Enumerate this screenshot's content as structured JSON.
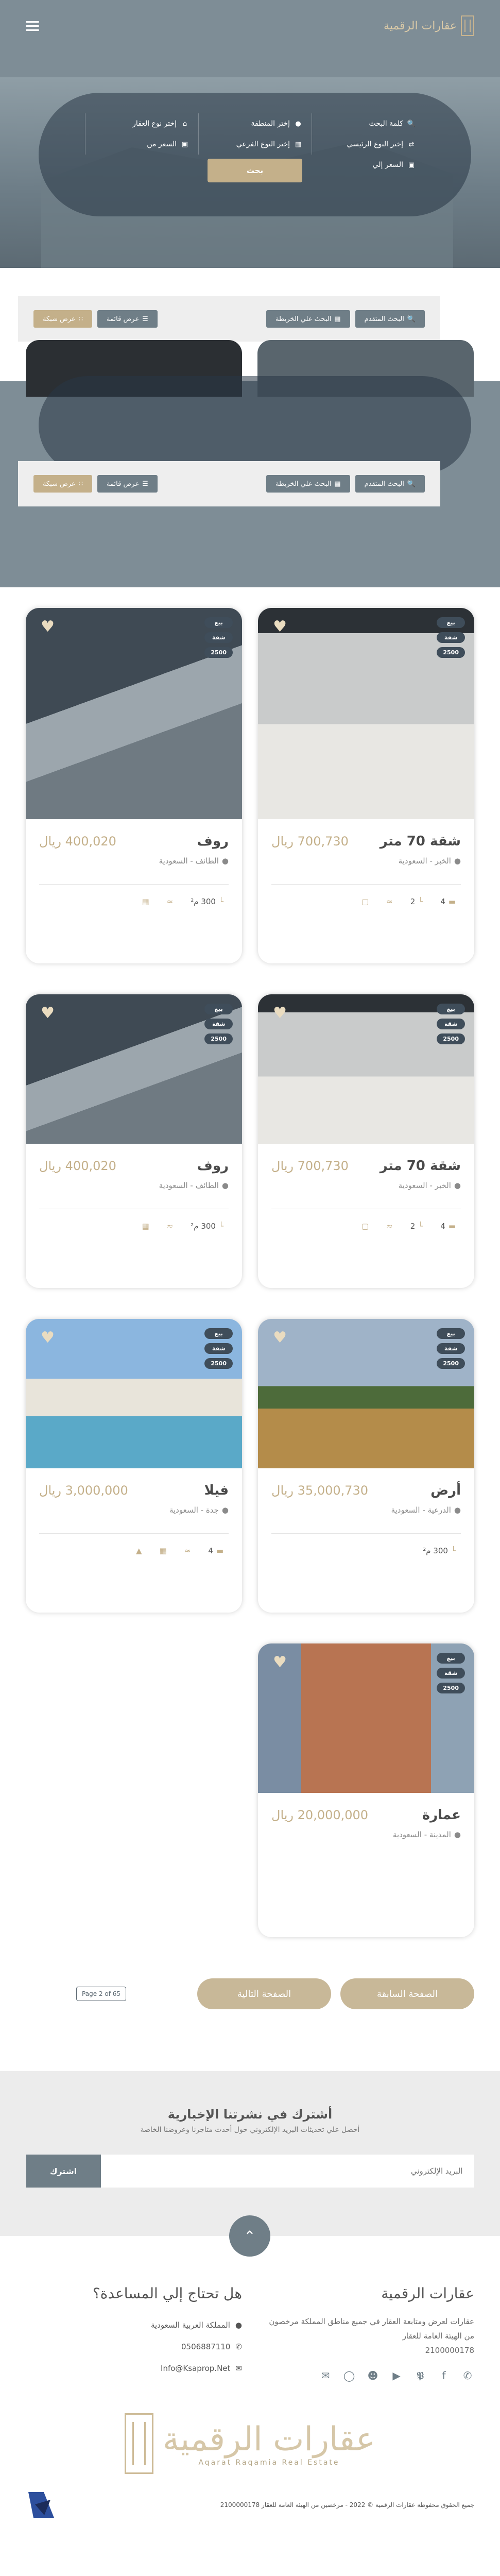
{
  "header": {
    "brand": "عقارات الرقمية",
    "menu_icon": "hamburger-icon"
  },
  "search": {
    "fields": [
      {
        "icon": "search-icon",
        "label": "كلمة البحث"
      },
      {
        "icon": "swap-icon",
        "label": "إختر النوع الرئيسي"
      },
      {
        "icon": "money-icon",
        "label": "السعر إلي"
      },
      {
        "icon": "pin-icon",
        "label": "إختر المنطقة"
      },
      {
        "icon": "building-icon",
        "label": "إختر النوع الفرعي"
      },
      {
        "icon": "home-icon",
        "label": "إختر نوع العقار"
      },
      {
        "icon": "money-icon",
        "label": "السعر من"
      }
    ],
    "submit": "بحث"
  },
  "toolbar": {
    "advanced": "البحث المتقدم",
    "map": "البحث علي الخريطة",
    "list": "عرض قائمة",
    "grid": "عرض شبكة"
  },
  "badges": {
    "b1": "بيع",
    "b2": "شقة",
    "b3": "2500"
  },
  "listings": [
    {
      "title": "شقة 70 متر",
      "price": "700,730 ريال",
      "location": "الخبر - السعودية",
      "beds": "4",
      "baths": "2"
    },
    {
      "title": "روف",
      "price": "400,020 ريال",
      "location": "الطائف - السعودية",
      "area": "300 م²"
    },
    {
      "title": "شقة 70 متر",
      "price": "700,730 ريال",
      "location": "الخبر - السعودية",
      "beds": "4",
      "baths": "2"
    },
    {
      "title": "روف",
      "price": "400,020 ريال",
      "location": "الطائف - السعودية",
      "area": "300 م²"
    },
    {
      "title": "أرض",
      "price": "35,000,730 ريال",
      "location": "الدرعية - السعودية",
      "area": "300 م²"
    },
    {
      "title": "فيلا",
      "price": "3,000,000 ريال",
      "location": "جدة - السعودية",
      "beds": "4"
    },
    {
      "title": "عمارة",
      "price": "20,000,000 ريال",
      "location": "المدينة - السعودية"
    }
  ],
  "pagination": {
    "prev": "الصفحة السابقة",
    "next": "الصفحة التالية",
    "info": "Page 2 of 65"
  },
  "newsletter": {
    "title": "أشترك في نشرتنا الإخبارية",
    "subtitle": "أحصل علي تحديثات البريد الإلكتروني حول أحدث متاجرنا وعروضنا الخاصة",
    "placeholder": "البريد الإلكتروني",
    "button": "اشترك"
  },
  "footer": {
    "about_title": "عقارات الرقمية",
    "about_text": "عقارات لعرض ومتابعة العقار في جميع مناطق المملكة مرخصون من الهيئة العامة للعقار",
    "license": "2100000178",
    "help_title": "هل تحتاج إلي المساعدة؟",
    "country": "المملكة العربية السعودية",
    "phone": "0506887110",
    "email": "Info@Ksaprop.Net",
    "brand_ar": "عقارات الرقمية",
    "brand_en": "Aqarat Raqamia Real Estate",
    "copyright": "جميع الحقوق محفوظة عقارات الرقمية © 2022 - مرخصين من الهيئة العامة للعقار 2100000178"
  }
}
